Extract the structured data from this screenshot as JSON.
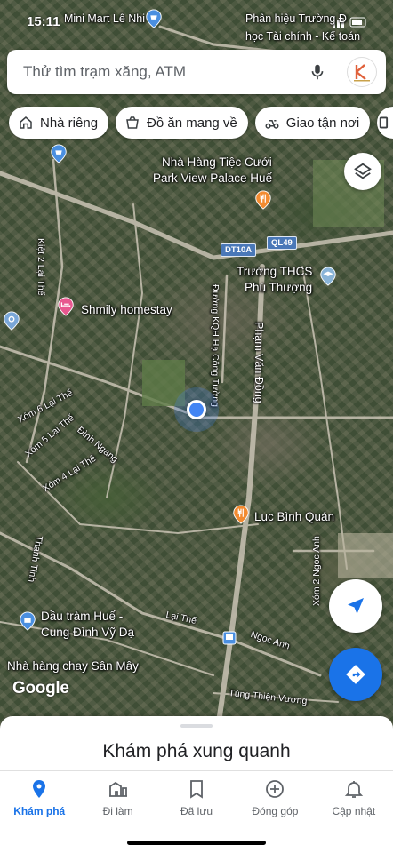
{
  "status_bar": {
    "time": "15:11"
  },
  "search": {
    "placeholder": "Thử tìm trạm xăng, ATM"
  },
  "chips": [
    {
      "label": "Nhà riêng",
      "icon": "home-icon"
    },
    {
      "label": "Đồ ăn mang về",
      "icon": "takeout-icon"
    },
    {
      "label": "Giao tận nơi",
      "icon": "delivery-icon"
    }
  ],
  "map": {
    "labels": {
      "minimart": "Mini Mart Lê Nhi",
      "phan_hieu": "Phân hiệu Trường Đ",
      "tai_chinh": "học Tài chính - Kế toán",
      "nha_hang_1": "Nhà Hàng Tiệc Cưới",
      "nha_hang_2": "Park View Palace Huế",
      "dt10a": "DT10A",
      "ql49": "QL49",
      "thcs_1": "Trường THCS",
      "thcs_2": "Phú Thượng",
      "kiet_lai_the": "Kiệt 2 Lại Thế",
      "shmily": "Shmily homestay",
      "ha_cong_tuong": "Đường KQH Hạ Công Tường",
      "pham_van_dong": "Phạm Văn Đồng",
      "xom6": "Xóm 6 Lại Thế",
      "xom5": "Xóm 5 Lại Thế",
      "xom4": "Xóm 4 Lại Thế",
      "dinh_ngang": "Đình Ngang",
      "luc_binh_quan": "Lục Bình Quán",
      "thanh_tinh": "Thanh Tịnh",
      "xom2": "Xóm 2 Ngọc Anh",
      "dau_tram_1": "Dầu tràm Huế -",
      "dau_tram_2": "Cung Đình Vỹ Dạ",
      "lai_the": "Lại Thế",
      "ngoc_anh": "Ngọc Anh",
      "nha_hang_chay": "Nhà hàng chay Sân Mây",
      "tung_thien": "Tùng Thiện Vương"
    },
    "attribution": "Google"
  },
  "bottom_sheet": {
    "title": "Khám phá xung quanh"
  },
  "nav": [
    {
      "label": "Khám phá",
      "icon": "explore-pin-icon",
      "active": true
    },
    {
      "label": "Đi làm",
      "icon": "commute-icon",
      "active": false
    },
    {
      "label": "Đã lưu",
      "icon": "bookmark-icon",
      "active": false
    },
    {
      "label": "Đóng góp",
      "icon": "add-circle-icon",
      "active": false
    },
    {
      "label": "Cập nhật",
      "icon": "bell-icon",
      "active": false
    }
  ],
  "colors": {
    "accent": "#1a73e8",
    "poi_orange": "#f28b31",
    "poi_pink": "#e8578f",
    "poi_blue": "#4a8fe0"
  }
}
